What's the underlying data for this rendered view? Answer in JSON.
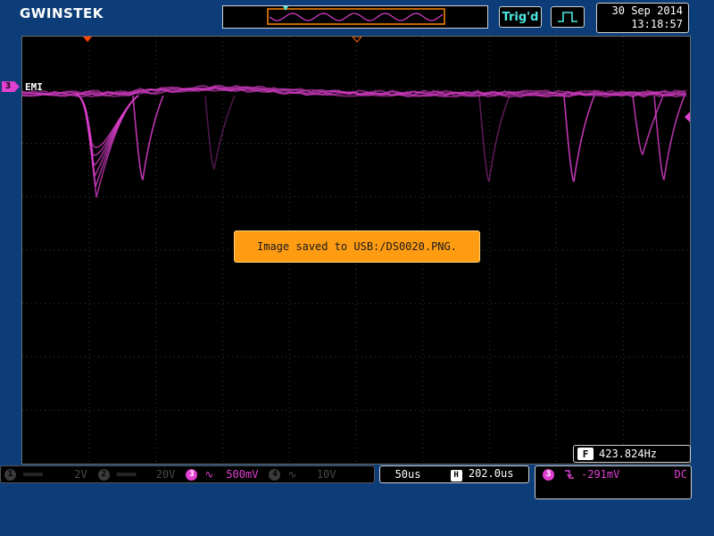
{
  "brand": {
    "logo": "GWINSTEK"
  },
  "status": {
    "trigger_state": "Trig'd"
  },
  "clock": {
    "date": "30 Sep 2014",
    "time": "13:18:57"
  },
  "channel_marker": {
    "number": "3",
    "label": "EMI"
  },
  "message": {
    "text": "Image saved to USB:/DS0020.PNG."
  },
  "frequency": {
    "icon_letter": "F",
    "value": "423.824Hz"
  },
  "channels": [
    {
      "num": "1",
      "coupling": "═══",
      "scale": "2V"
    },
    {
      "num": "2",
      "coupling": "═══",
      "scale": "20V"
    },
    {
      "num": "3",
      "coupling": "∿",
      "scale": "500mV"
    },
    {
      "num": "4",
      "coupling": "∿",
      "scale": "10V"
    }
  ],
  "timebase": {
    "scale": "50us",
    "h_icon": "H",
    "position": "202.0us"
  },
  "trigger": {
    "source": "3",
    "slope_icon": "falling-edge-icon",
    "level": "-291mV",
    "coupling": "DC"
  },
  "colors": {
    "ch3": "#e040d0",
    "background": "#0c3d78",
    "message_bg": "#ff9c12",
    "trigger_text": "#4ee8e0"
  }
}
